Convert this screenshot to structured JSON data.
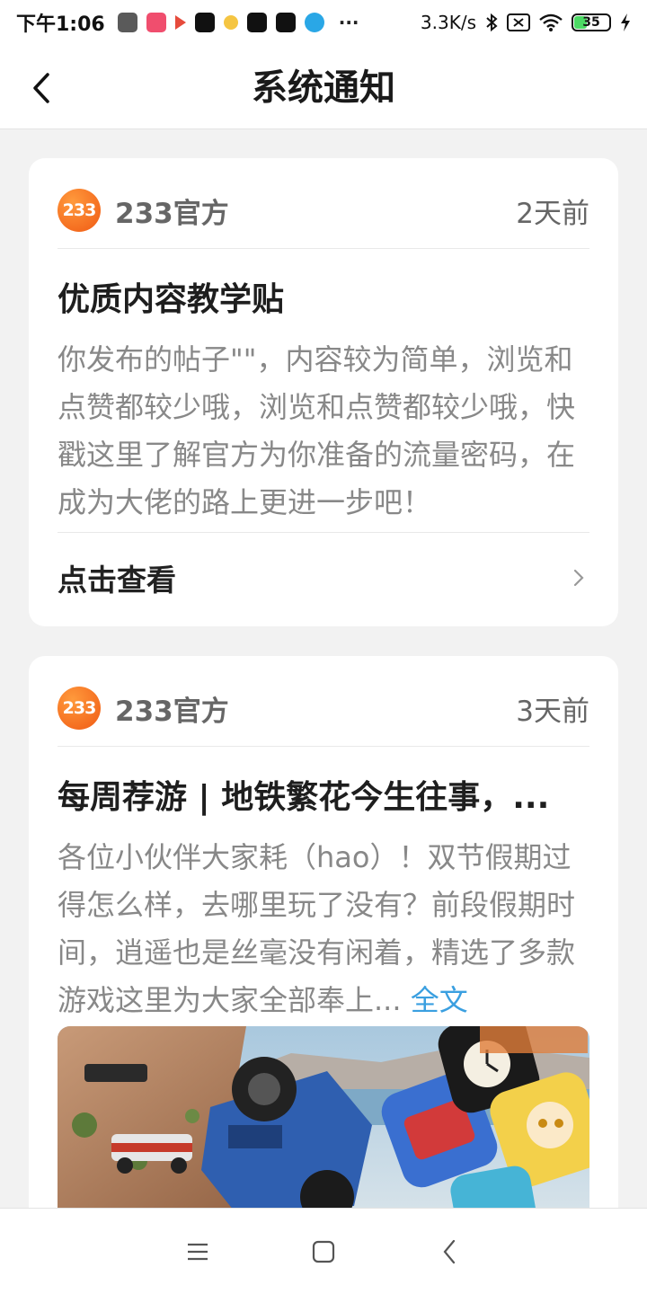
{
  "status_bar": {
    "time": "下午1:06",
    "network_speed": "3.3K/s",
    "battery_level": "35",
    "battery_percent": 35,
    "more": "···",
    "app_icons": [
      "mi-app-icon",
      "weibo-app-icon",
      "play-app-icon",
      "tiktok-app-icon",
      "moon-app-icon",
      "tiktok-app-icon",
      "tiktok-app-icon",
      "blue-app-icon"
    ],
    "icons": [
      "bluetooth-icon",
      "sim-off-icon",
      "wifi-icon",
      "battery-icon",
      "charging-icon"
    ]
  },
  "header": {
    "title": "系统通知",
    "back_icon": "chevron-left-icon"
  },
  "notifications": [
    {
      "logo_text": "233",
      "sender": "233官方",
      "time": "2天前",
      "title": "优质内容教学贴",
      "body": "你发布的帖子\"\"，内容较为简单，浏览和点赞都较少哦，浏览和点赞都较少哦，快戳这里了解官方为你准备的流量密码，在成为大佬的路上更进一步吧！",
      "action_label": "点击查看",
      "action_icon": "chevron-right-icon"
    },
    {
      "logo_text": "233",
      "sender": "233官方",
      "time": "3天前",
      "title": "每周荐游 | 地铁繁花今生往事，...",
      "body": "各位小伙伴大家耗（hao）！双节假期过得怎么样，去哪里玩了没有？前段假期时间，逍遥也是丝毫没有闲着，精选了多款游戏这里为大家全部奉上...",
      "fulltext_label": "全文",
      "banner_image": "game-collage-image"
    }
  ],
  "nav_bar": {
    "icons": [
      "menu-icon",
      "home-icon",
      "back-icon"
    ]
  },
  "colors": {
    "accent_link": "#3a9fe0",
    "brand_orange": "#f05a14",
    "background": "#f2f2f2"
  }
}
